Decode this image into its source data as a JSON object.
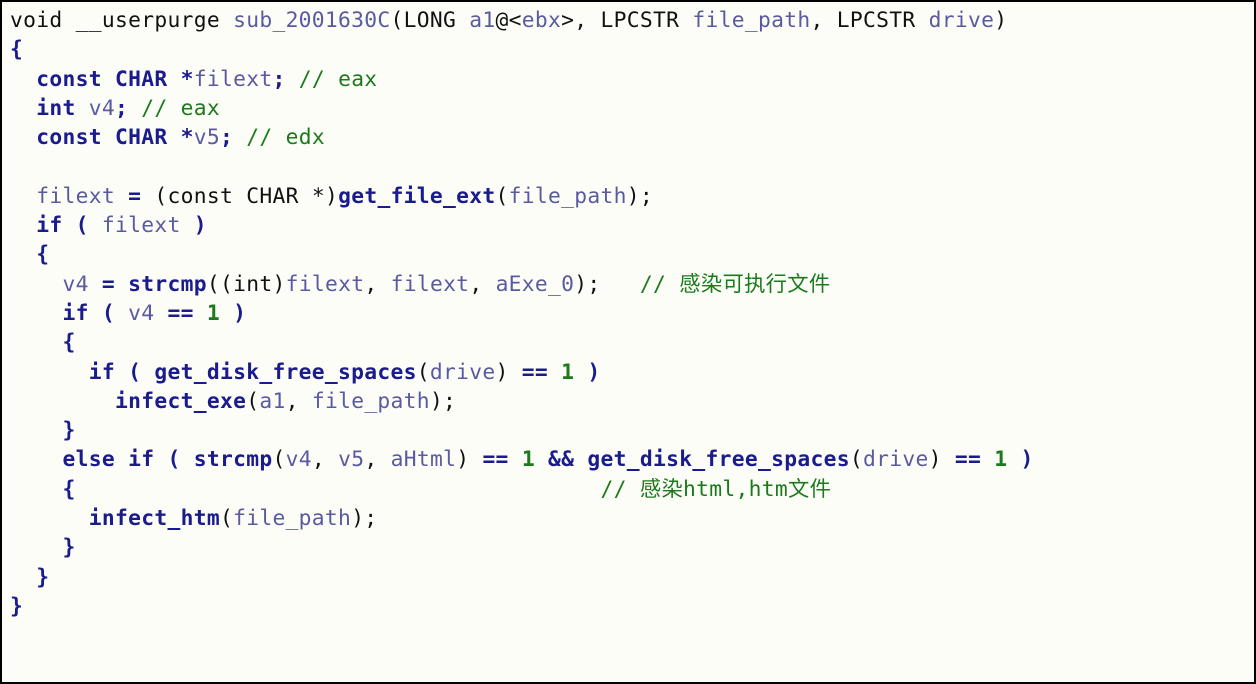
{
  "code": {
    "lines": [
      {
        "indent": 0,
        "segments": [
          {
            "c": "tk-plain",
            "t": "void __userpurge "
          },
          {
            "c": "tk-id",
            "t": "sub_2001630C"
          },
          {
            "c": "tk-plain",
            "t": "(LONG "
          },
          {
            "c": "tk-id",
            "t": "a1"
          },
          {
            "c": "tk-plain",
            "t": "@<"
          },
          {
            "c": "tk-id",
            "t": "ebx"
          },
          {
            "c": "tk-plain",
            "t": ">, LPCSTR "
          },
          {
            "c": "tk-id",
            "t": "file_path"
          },
          {
            "c": "tk-plain",
            "t": ", LPCSTR "
          },
          {
            "c": "tk-id",
            "t": "drive"
          },
          {
            "c": "tk-plain",
            "t": ")"
          }
        ]
      },
      {
        "indent": 0,
        "segments": [
          {
            "c": "tk-kw",
            "t": "{"
          }
        ]
      },
      {
        "indent": 1,
        "segments": [
          {
            "c": "tk-kw",
            "t": "const CHAR *"
          },
          {
            "c": "tk-id",
            "t": "filext"
          },
          {
            "c": "tk-kw",
            "t": "; "
          },
          {
            "c": "tk-cmt",
            "t": "// eax"
          }
        ]
      },
      {
        "indent": 1,
        "segments": [
          {
            "c": "tk-kw",
            "t": "int "
          },
          {
            "c": "tk-id",
            "t": "v4"
          },
          {
            "c": "tk-kw",
            "t": "; "
          },
          {
            "c": "tk-cmt",
            "t": "// eax"
          }
        ]
      },
      {
        "indent": 1,
        "segments": [
          {
            "c": "tk-kw",
            "t": "const CHAR *"
          },
          {
            "c": "tk-id",
            "t": "v5"
          },
          {
            "c": "tk-kw",
            "t": "; "
          },
          {
            "c": "tk-cmt",
            "t": "// edx"
          }
        ]
      },
      {
        "indent": 0,
        "segments": [
          {
            "c": "tk-plain",
            "t": ""
          }
        ]
      },
      {
        "indent": 1,
        "segments": [
          {
            "c": "tk-id",
            "t": "filext"
          },
          {
            "c": "tk-kw",
            "t": " = "
          },
          {
            "c": "tk-plain",
            "t": "(const CHAR *)"
          },
          {
            "c": "tk-kw",
            "t": "get_file_ext"
          },
          {
            "c": "tk-plain",
            "t": "("
          },
          {
            "c": "tk-id",
            "t": "file_path"
          },
          {
            "c": "tk-plain",
            "t": ");"
          }
        ]
      },
      {
        "indent": 1,
        "segments": [
          {
            "c": "tk-kw",
            "t": "if ( "
          },
          {
            "c": "tk-id",
            "t": "filext"
          },
          {
            "c": "tk-kw",
            "t": " )"
          }
        ]
      },
      {
        "indent": 1,
        "segments": [
          {
            "c": "tk-kw",
            "t": "{"
          }
        ]
      },
      {
        "indent": 2,
        "segments": [
          {
            "c": "tk-id",
            "t": "v4"
          },
          {
            "c": "tk-kw",
            "t": " = strcmp"
          },
          {
            "c": "tk-plain",
            "t": "((int)"
          },
          {
            "c": "tk-id",
            "t": "filext"
          },
          {
            "c": "tk-plain",
            "t": ", "
          },
          {
            "c": "tk-id",
            "t": "filext"
          },
          {
            "c": "tk-plain",
            "t": ", "
          },
          {
            "c": "tk-id",
            "t": "aExe_0"
          },
          {
            "c": "tk-plain",
            "t": ");   "
          },
          {
            "c": "tk-cmt",
            "t": "// 感染可执行文件"
          }
        ]
      },
      {
        "indent": 2,
        "segments": [
          {
            "c": "tk-kw",
            "t": "if ( "
          },
          {
            "c": "tk-id",
            "t": "v4"
          },
          {
            "c": "tk-kw",
            "t": " == "
          },
          {
            "c": "tk-num",
            "t": "1"
          },
          {
            "c": "tk-kw",
            "t": " )"
          }
        ]
      },
      {
        "indent": 2,
        "segments": [
          {
            "c": "tk-kw",
            "t": "{"
          }
        ]
      },
      {
        "indent": 3,
        "segments": [
          {
            "c": "tk-kw",
            "t": "if ( get_disk_free_spaces"
          },
          {
            "c": "tk-plain",
            "t": "("
          },
          {
            "c": "tk-id",
            "t": "drive"
          },
          {
            "c": "tk-plain",
            "t": ") "
          },
          {
            "c": "tk-kw",
            "t": "== "
          },
          {
            "c": "tk-num",
            "t": "1"
          },
          {
            "c": "tk-kw",
            "t": " )"
          }
        ]
      },
      {
        "indent": 4,
        "segments": [
          {
            "c": "tk-kw",
            "t": "infect_exe"
          },
          {
            "c": "tk-plain",
            "t": "("
          },
          {
            "c": "tk-id",
            "t": "a1"
          },
          {
            "c": "tk-plain",
            "t": ", "
          },
          {
            "c": "tk-id",
            "t": "file_path"
          },
          {
            "c": "tk-plain",
            "t": ");"
          }
        ]
      },
      {
        "indent": 2,
        "segments": [
          {
            "c": "tk-kw",
            "t": "}"
          }
        ]
      },
      {
        "indent": 2,
        "segments": [
          {
            "c": "tk-kw",
            "t": "else if ( strcmp"
          },
          {
            "c": "tk-plain",
            "t": "("
          },
          {
            "c": "tk-id",
            "t": "v4"
          },
          {
            "c": "tk-plain",
            "t": ", "
          },
          {
            "c": "tk-id",
            "t": "v5"
          },
          {
            "c": "tk-plain",
            "t": ", "
          },
          {
            "c": "tk-id",
            "t": "aHtml"
          },
          {
            "c": "tk-plain",
            "t": ") "
          },
          {
            "c": "tk-kw",
            "t": "== "
          },
          {
            "c": "tk-num",
            "t": "1"
          },
          {
            "c": "tk-kw",
            "t": " && get_disk_free_spaces"
          },
          {
            "c": "tk-plain",
            "t": "("
          },
          {
            "c": "tk-id",
            "t": "drive"
          },
          {
            "c": "tk-plain",
            "t": ") "
          },
          {
            "c": "tk-kw",
            "t": "== "
          },
          {
            "c": "tk-num",
            "t": "1"
          },
          {
            "c": "tk-kw",
            "t": " )"
          }
        ]
      },
      {
        "indent": 2,
        "segments": [
          {
            "c": "tk-kw",
            "t": "{"
          },
          {
            "c": "tk-plain",
            "t": "                                        "
          },
          {
            "c": "tk-cmt",
            "t": "// 感染html,htm文件"
          }
        ]
      },
      {
        "indent": 3,
        "segments": [
          {
            "c": "tk-kw",
            "t": "infect_htm"
          },
          {
            "c": "tk-plain",
            "t": "("
          },
          {
            "c": "tk-id",
            "t": "file_path"
          },
          {
            "c": "tk-plain",
            "t": ");"
          }
        ]
      },
      {
        "indent": 2,
        "segments": [
          {
            "c": "tk-kw",
            "t": "}"
          }
        ]
      },
      {
        "indent": 1,
        "segments": [
          {
            "c": "tk-kw",
            "t": "}"
          }
        ]
      },
      {
        "indent": 0,
        "segments": [
          {
            "c": "tk-kw",
            "t": "}"
          }
        ]
      }
    ]
  }
}
